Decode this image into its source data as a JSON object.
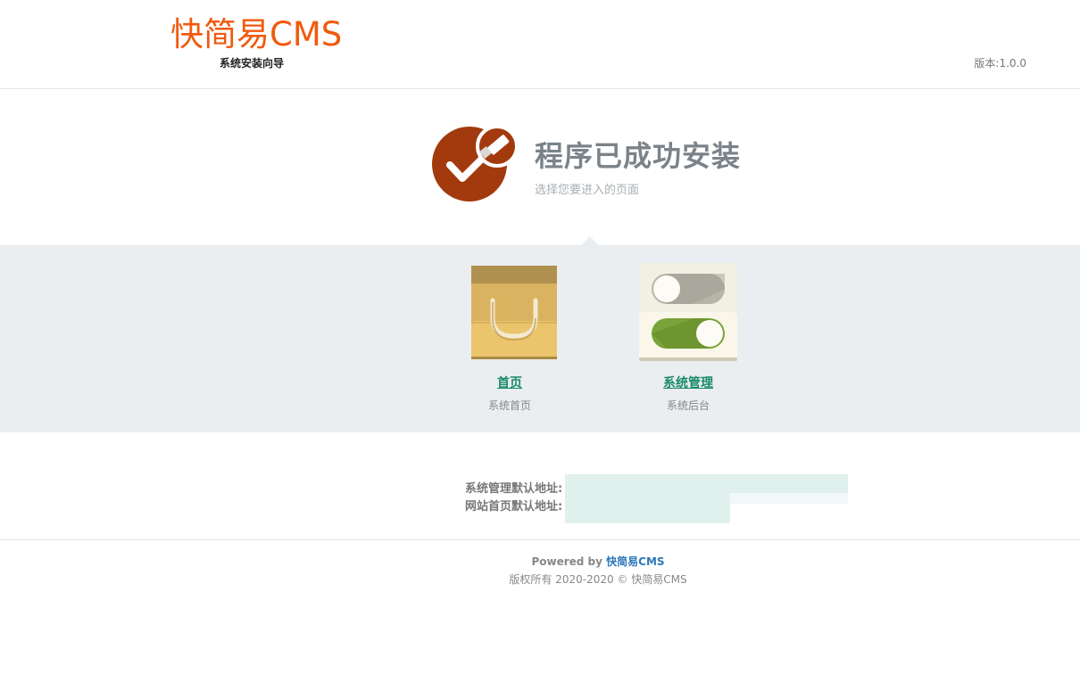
{
  "header": {
    "logo": "快简易CMS",
    "logo_subtitle": "系统安装向导",
    "version": "版本:1.0.0"
  },
  "hero": {
    "icon": "check-icon",
    "title": "程序已成功安装",
    "subtitle": "选择您要进入的页面"
  },
  "choices": [
    {
      "icon": "shopping-bag-icon",
      "label": "首页",
      "desc": "系统首页"
    },
    {
      "icon": "toggle-switches-icon",
      "label": "系统管理",
      "desc": "系统后台"
    }
  ],
  "addresses": {
    "admin_label": "系统管理默认地址:",
    "site_label": "网站首页默认地址:"
  },
  "footer": {
    "powered_prefix": "Powered by ",
    "powered_brand": "快简易CMS",
    "copyright": "版权所有 2020-2020 © 快简易CMS"
  },
  "colors": {
    "brand_orange": "#f05a0f",
    "check_red": "#a23a0e",
    "band_gray": "#eaeef0",
    "link_green": "#1a8a66"
  }
}
